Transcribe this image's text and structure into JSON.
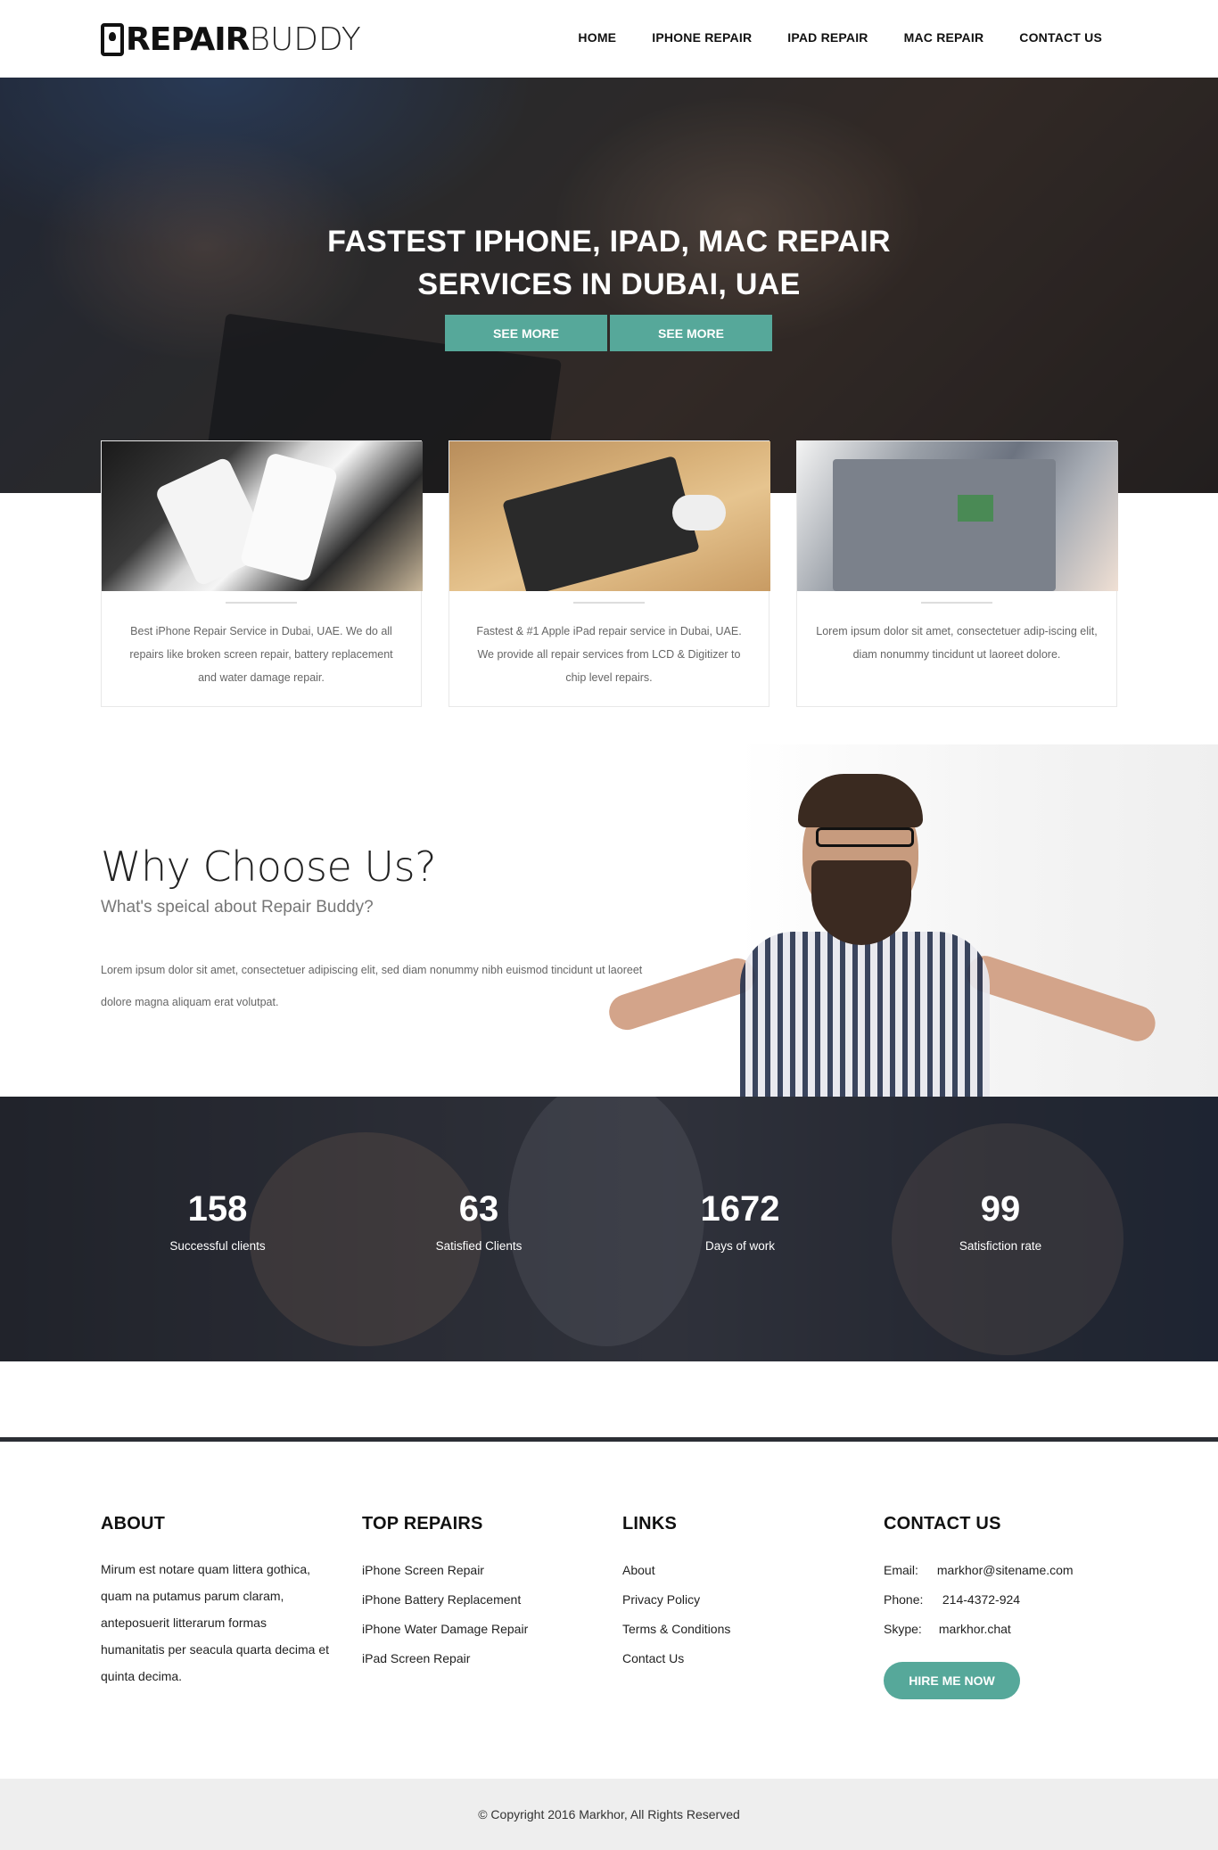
{
  "header": {
    "logo_bold": "REPAIR",
    "logo_light": "BUDDY",
    "nav": [
      "HOME",
      "IPHONE REPAIR",
      "IPAD REPAIR",
      "MAC REPAIR",
      "CONTACT US"
    ]
  },
  "hero": {
    "title_line1": "FASTEST IPHONE, IPAD, MAC REPAIR",
    "title_line2": "SERVICES IN DUBAI, UAE",
    "button1": "SEE MORE",
    "button2": "SEE MORE"
  },
  "cards": [
    {
      "text": "Best iPhone Repair Service in Dubai, UAE. We do all repairs like broken screen repair, battery replacement and water damage repair."
    },
    {
      "text": "Fastest & #1 Apple iPad repair service in Dubai, UAE. We provide all repair services from LCD & Digitizer to chip level repairs."
    },
    {
      "text": "Lorem ipsum dolor sit amet, consectetuer adip-iscing elit, diam nonummy tincidunt ut laoreet dolore."
    }
  ],
  "why": {
    "title": "Why Choose Us?",
    "subtitle": "What's speical about Repair Buddy?",
    "text": "Lorem ipsum dolor sit amet, consectetuer adipiscing elit, sed diam nonummy nibh euismod tincidunt ut laoreet dolore magna aliquam erat volutpat."
  },
  "stats": [
    {
      "value": "158",
      "label": "Successful clients"
    },
    {
      "value": "63",
      "label": "Satisfied Clients"
    },
    {
      "value": "1672",
      "label": "Days of work"
    },
    {
      "value": "99",
      "label": "Satisfiction rate"
    }
  ],
  "footer": {
    "about": {
      "heading": "ABOUT",
      "text": "Mirum est notare quam littera gothica, quam na putamus parum claram, anteposuerit litterarum formas humanitatis per seacula quarta decima et quinta decima."
    },
    "top_repairs": {
      "heading": "TOP REPAIRS",
      "items": [
        "iPhone Screen Repair",
        "iPhone Battery Replacement",
        "iPhone Water Damage Repair",
        "iPad Screen Repair"
      ]
    },
    "links": {
      "heading": "LINKS",
      "items": [
        "About",
        "Privacy Policy",
        "Terms & Conditions",
        "Contact Us"
      ]
    },
    "contact": {
      "heading": "CONTACT US",
      "email_label": "Email:",
      "email": "markhor@sitename.com",
      "phone_label": "Phone:",
      "phone": "214-4372-924",
      "skype_label": "Skype:",
      "skype": "markhor.chat",
      "button": "HIRE ME NOW"
    }
  },
  "copyright": "© Copyright 2016 Markhor, All Rights Reserved",
  "colors": {
    "accent": "#56a89a",
    "text_dark": "#111111",
    "footer_bg": "#eeeeee"
  }
}
